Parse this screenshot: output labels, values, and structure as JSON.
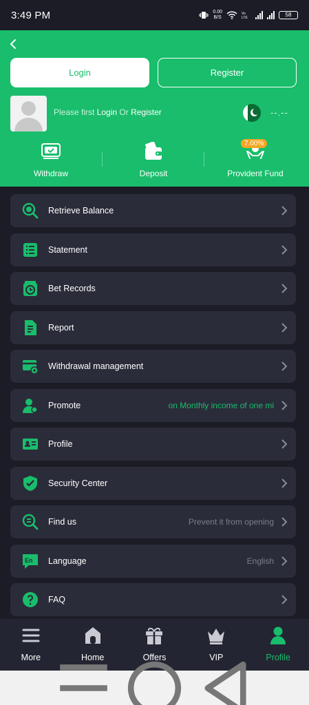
{
  "status_bar": {
    "time": "3:49 PM",
    "net_speed_top": "0.00",
    "net_speed_bottom": "B/S",
    "battery": "58"
  },
  "header": {
    "login_label": "Login",
    "register_label": "Register",
    "hint_prefix": "Please first ",
    "hint_login": "Login",
    "hint_or": " Or ",
    "hint_register": "Register",
    "balance": "--.--",
    "quick_actions": [
      {
        "label": "Withdraw",
        "icon": "wallet-card-icon"
      },
      {
        "label": "Deposit",
        "icon": "wallet-icon"
      },
      {
        "label": "Provident Fund",
        "icon": "hand-coins-icon",
        "badge": "7.00%"
      }
    ]
  },
  "menu": [
    {
      "label": "Retrieve Balance",
      "value": "",
      "icon": "magnifier-coin-icon"
    },
    {
      "label": "Statement",
      "value": "",
      "icon": "list-icon"
    },
    {
      "label": "Bet Records",
      "value": "",
      "icon": "clock-icon"
    },
    {
      "label": "Report",
      "value": "",
      "icon": "document-icon"
    },
    {
      "label": "Withdrawal management",
      "value": "",
      "icon": "card-gear-icon"
    },
    {
      "label": "Promote",
      "value": "on  Monthly income of one mi",
      "icon": "user-promote-icon"
    },
    {
      "label": "Profile",
      "value": "",
      "icon": "id-card-icon"
    },
    {
      "label": "Security Center",
      "value": "",
      "icon": "shield-check-icon"
    },
    {
      "label": "Find us",
      "value": "Prevent it from opening",
      "icon": "magnifier-icon"
    },
    {
      "label": "Language",
      "value": "English",
      "icon": "language-icon"
    },
    {
      "label": "FAQ",
      "value": "",
      "icon": "question-icon"
    }
  ],
  "tabs": [
    {
      "label": "More",
      "icon": "menu-icon"
    },
    {
      "label": "Home",
      "icon": "home-icon"
    },
    {
      "label": "Offers",
      "icon": "gift-icon"
    },
    {
      "label": "VIP",
      "icon": "crown-icon"
    },
    {
      "label": "Profile",
      "icon": "user-icon"
    }
  ],
  "colors": {
    "accent": "#19bd6b",
    "background": "#1b1c25",
    "card": "#2b2c3a",
    "tabbar": "#242533",
    "badge": "#f6a623"
  }
}
